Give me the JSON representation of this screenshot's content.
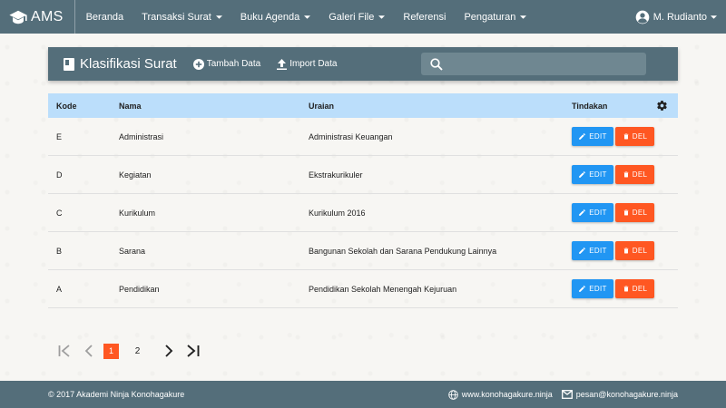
{
  "app": {
    "brand": "AMS"
  },
  "nav": {
    "items": [
      {
        "label": "Beranda",
        "dropdown": false
      },
      {
        "label": "Transaksi Surat",
        "dropdown": true
      },
      {
        "label": "Buku Agenda",
        "dropdown": true
      },
      {
        "label": "Galeri File",
        "dropdown": true
      },
      {
        "label": "Referensi",
        "dropdown": false
      },
      {
        "label": "Pengaturan",
        "dropdown": true
      }
    ],
    "user": "M. Rudianto"
  },
  "header": {
    "title": "Klasifikasi Surat",
    "add_label": "Tambah Data",
    "import_label": "Import Data",
    "search_placeholder": "",
    "search_value": ""
  },
  "table": {
    "columns": {
      "kode": "Kode",
      "nama": "Nama",
      "uraian": "Uraian",
      "tindakan": "Tindakan"
    },
    "edit_label": "EDIT",
    "del_label": "DEL",
    "rows": [
      {
        "kode": "E",
        "nama": "Administrasi",
        "uraian": "Administrasi Keuangan"
      },
      {
        "kode": "D",
        "nama": "Kegiatan",
        "uraian": "Ekstrakurikuler"
      },
      {
        "kode": "C",
        "nama": "Kurikulum",
        "uraian": "Kurikulum 2016"
      },
      {
        "kode": "B",
        "nama": "Sarana",
        "uraian": "Bangunan Sekolah dan Sarana Pendukung Lainnya"
      },
      {
        "kode": "A",
        "nama": "Pendidikan",
        "uraian": "Pendidikan Sekolah Menengah Kejuruan"
      }
    ]
  },
  "pagination": {
    "current": "1",
    "pages": [
      "1",
      "2"
    ]
  },
  "footer": {
    "copyright": "© 2017 Akademi Ninja Konohagakure",
    "website": "www.konohagakure.ninja",
    "email": "pesan@konohagakure.ninja"
  },
  "colors": {
    "primary": "#546e7a",
    "table_header": "#bbdefb",
    "edit": "#2196f3",
    "delete": "#ff5722",
    "active_page": "#ff5722"
  },
  "icons": {
    "brand": "graduation-cap-icon",
    "user": "account-circle-icon",
    "title": "book-icon",
    "add": "add-circle-icon",
    "import": "upload-icon",
    "search": "search-icon",
    "settings": "gear-icon",
    "edit": "pencil-icon",
    "delete": "trash-icon"
  }
}
